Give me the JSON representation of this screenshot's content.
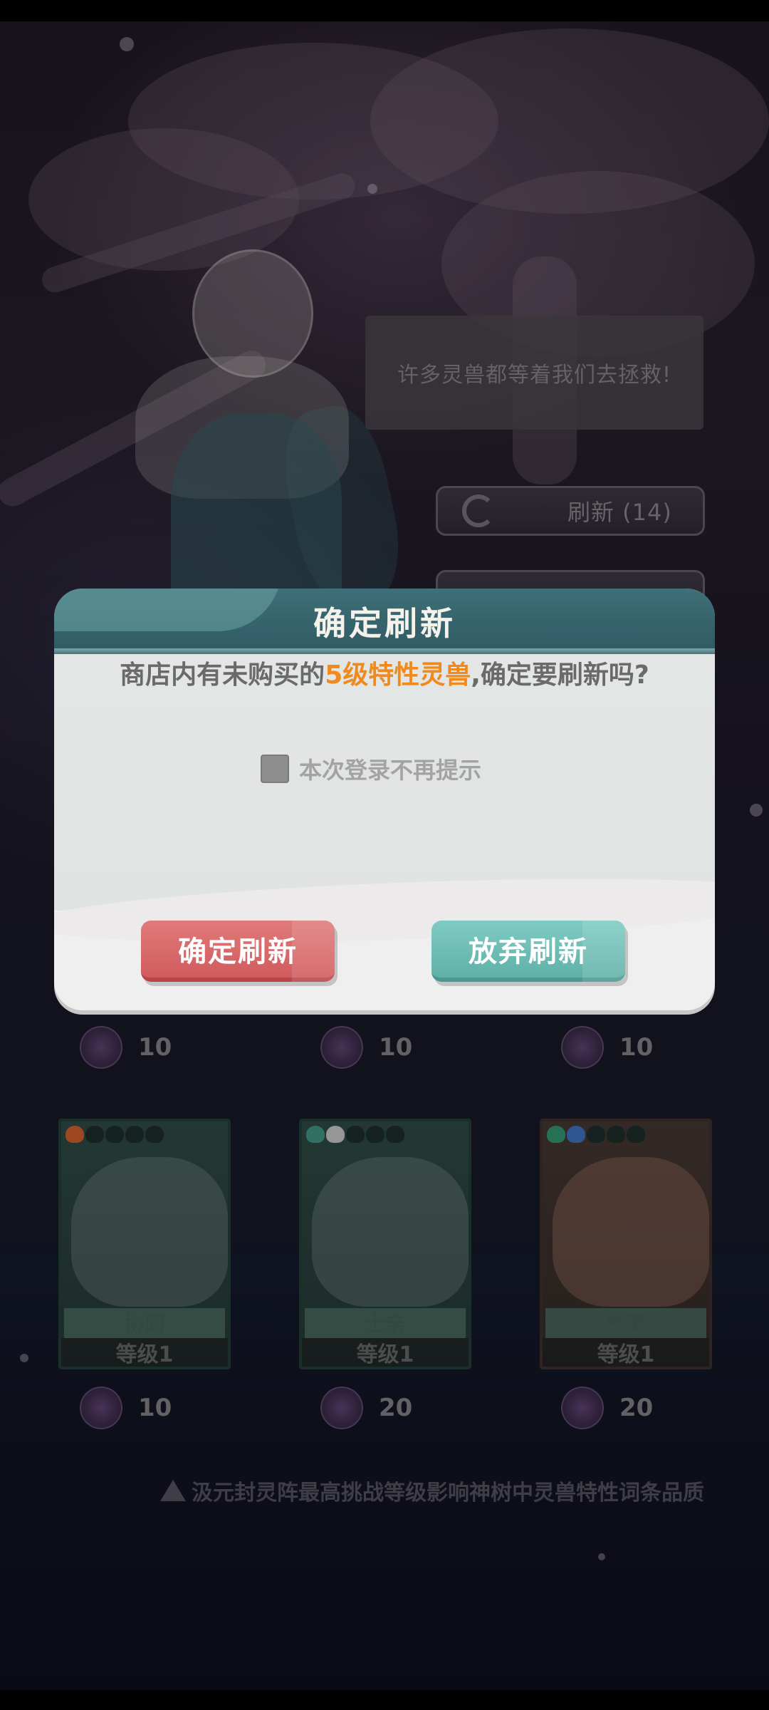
{
  "scene": {
    "speech_text": "许多灵兽都等着我们去拯救!",
    "refresh_button_label": "刷新 (14)",
    "second_button_label": ""
  },
  "shop": {
    "prices_row1": [
      "10",
      "10",
      "10"
    ],
    "cards": [
      {
        "trait": "协同",
        "level": "等级1",
        "price": "10",
        "paw_colors": [
          "#c0582a",
          "#1a2a28",
          "#1a2a28",
          "#1a2a28",
          "#1a2a28"
        ]
      },
      {
        "trait": "士亲",
        "level": "等级1",
        "price": "20",
        "paw_colors": [
          "#3b8a7a",
          "#b8b8b8",
          "#1a2a28",
          "#1a2a28",
          "#1a2a28"
        ]
      },
      {
        "trait": "气灵",
        "level": "等级1",
        "price": "20",
        "paw_colors": [
          "#2f8a6a",
          "#3a6ab0",
          "#1a2a28",
          "#1a2a28",
          "#1a2a28"
        ]
      }
    ],
    "notice": "汲元封灵阵最高挑战等级影响神树中灵兽特性词条品质"
  },
  "dialog": {
    "title": "确定刷新",
    "message_prefix": "商店内有未购买的",
    "message_highlight": "5级特性灵兽",
    "message_suffix": ",确定要刷新吗?",
    "checkbox_label": "本次登录不再提示",
    "confirm_label": "确定刷新",
    "cancel_label": "放弃刷新",
    "highlight_color": "#f08a1c",
    "header_color": "#3f6f78",
    "confirm_color": "#d15b5d",
    "cancel_color": "#5fb1a8"
  }
}
